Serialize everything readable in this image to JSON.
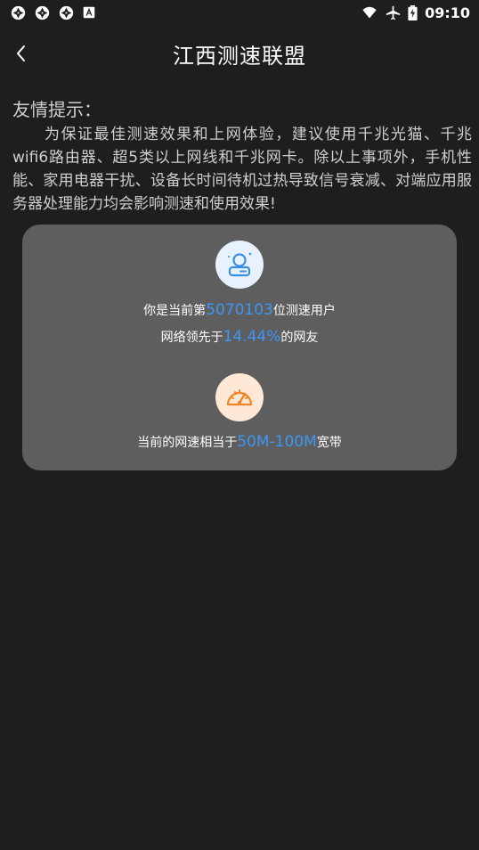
{
  "status_bar": {
    "time": "09:10",
    "left_icons": [
      "aperture-icon",
      "aperture-icon",
      "aperture-icon",
      "font-a-icon"
    ],
    "right_icons": [
      "wifi-icon",
      "airplane-icon",
      "battery-charging-icon"
    ]
  },
  "app_bar": {
    "back_icon": "chevron-left-icon",
    "title": "江西测速联盟"
  },
  "tip": {
    "heading": "友情提示：",
    "body": "为保证最佳测速效果和上网体验，建议使用千兆光猫、千兆wifi6路由器、超5类以上网线和千兆网卡。除以上事项外，手机性能、家用电器干扰、设备长时间待机过热导致信号衰减、对端应用服务器处理能力均会影响测速和使用效果!"
  },
  "card": {
    "rank_prefix": "你是当前第",
    "rank_value": "5070103",
    "rank_suffix": "位测速用户",
    "lead_prefix": "网络领先于",
    "lead_value": "14.44%",
    "lead_suffix": "的网友",
    "speed_prefix": "当前的网速相当于",
    "speed_value": "50M-100M",
    "speed_suffix": "宽带"
  },
  "colors": {
    "background": "#1e1e1e",
    "card": "#5e5e5e",
    "highlight": "#3d96f5",
    "user_icon": "#3a8ee6",
    "speed_icon": "#f0862a"
  }
}
